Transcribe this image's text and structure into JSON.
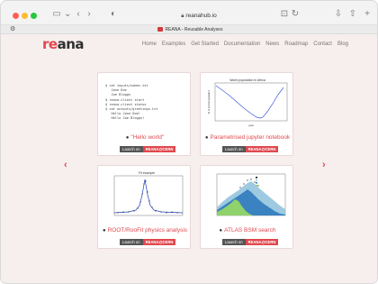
{
  "browser": {
    "url": "reanahub.io",
    "tab_title": "REANA - Reusable Analyses"
  },
  "site": {
    "logo_prefix": "re",
    "logo_rest": "ana",
    "brand_color": "#e0484f",
    "menu": [
      "Home",
      "Examples",
      "Get Started",
      "Documentation",
      "News",
      "Roadmap",
      "Contact",
      "Blog"
    ]
  },
  "cards": [
    {
      "title": "\"Hello world\"",
      "launch_a": "Launch on",
      "launch_b": "REANA@CERN",
      "code_lines": [
        "$ cat inputs/names.txt",
        "   Jane Doe",
        "   Joe Bloggs",
        "$ reana-client start",
        "$ reana-client status",
        "$ cat outputs/greetings.txt",
        "   Hello Jane Doe!",
        "   Hello Joe Bloggs!"
      ]
    },
    {
      "title": "Parametrised jupyter notebook",
      "launch_a": "Launch on",
      "launch_b": "REANA@CERN",
      "plot_title": "World population in Africa",
      "x_label": "year",
      "y_label": "% of world population"
    },
    {
      "title": "ROOT/RooFit physics analysis",
      "launch_a": "Launch on",
      "launch_b": "REANA@CERN",
      "plot_title": "Fit example"
    },
    {
      "title": "ATLAS BSM search",
      "launch_a": "Launch on",
      "launch_b": "REANA@CERN"
    }
  ]
}
